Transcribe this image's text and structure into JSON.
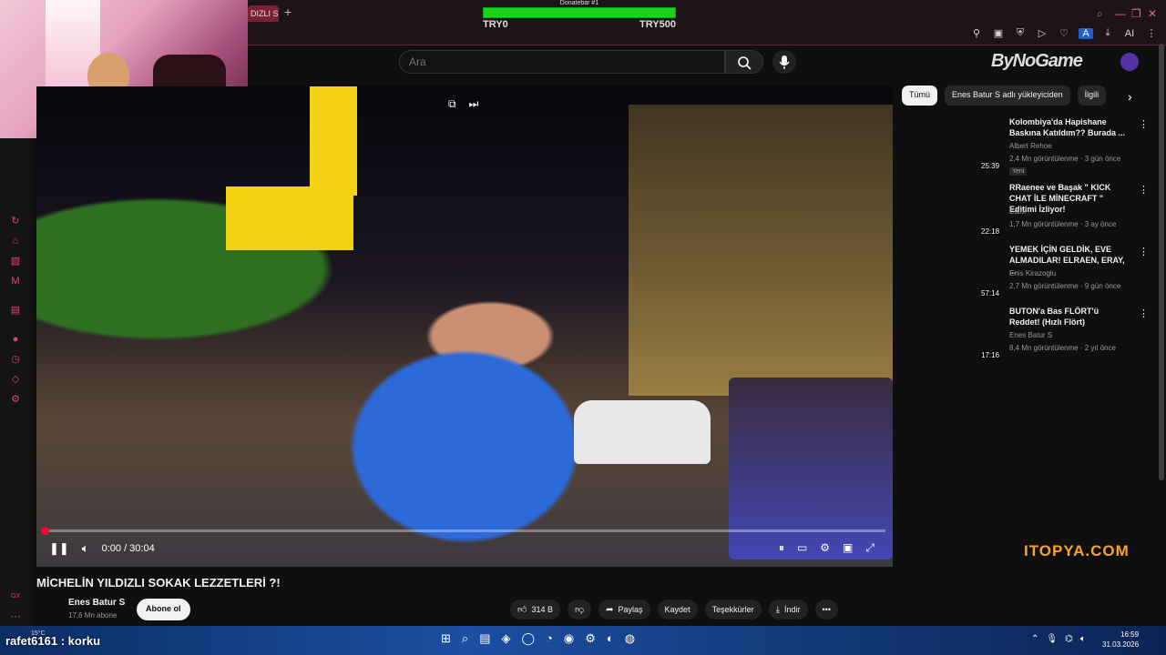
{
  "browser": {
    "tab_label": "DIZLI S(",
    "new_tab": "+",
    "accent": "#7a2136"
  },
  "donatebar": {
    "title": "Donatebar #1",
    "progress_fraction": 1.0,
    "min_label": "TRY0",
    "max_label": "TRY500",
    "fill_color": "#19d419"
  },
  "window_controls": {
    "search": "⌕",
    "minimize": "—",
    "restore": "❐",
    "close": "✕"
  },
  "extensions": [
    "pin-icon",
    "crop-icon",
    "shield-icon",
    "play-icon",
    "heart-icon",
    "A",
    "download-icon",
    "AI",
    "menu-icon"
  ],
  "ext_labels": {
    "a": "A",
    "ai": "AI"
  },
  "search": {
    "placeholder": "Ara"
  },
  "brand": {
    "logo_text": "ByNoGame"
  },
  "video": {
    "time": "0:00 / 30:04",
    "progress_fraction": 0.0,
    "accent": "#ff0033"
  },
  "chips": {
    "all": "Tümü",
    "uploads": "Enes Batur S adlı yükleyiciden",
    "related": "İlgili"
  },
  "recommendations": [
    {
      "title": "Kolombiya'da Hapishane Baskına Katıldım?? Burada ...",
      "channel": "Albert Rehoe",
      "meta": "2,4 Mn görüntülenme · 3 gün önce",
      "badge": "Yeni",
      "duration": "25:39"
    },
    {
      "title": "RRaenee ve Başak \" KICK CHAT İLE MİNECRAFT \" Editimi İzliyor!",
      "channel": "Edior",
      "meta": "1,7 Mn görüntülenme · 3 ay önce",
      "badge": "",
      "duration": "22:18"
    },
    {
      "title": "YEMEK İÇİN GELDİK, EVE ALMADILAR! ELRAEN, ERAY, ...",
      "channel": "Enis Kirazoglu",
      "meta": "2,7 Mn görüntülenme · 9 gün önce",
      "badge": "",
      "duration": "57:14"
    },
    {
      "title": "BUTON'a Bas FLÖRT'ü Reddet! (Hızlı Flört)",
      "channel": "Enes Batur S",
      "meta": "8,4 Mn görüntülenme · 2 yıl önce",
      "badge": "",
      "duration": "17:16"
    }
  ],
  "watermark": "ITOPYA.COM",
  "watch": {
    "title": "MİCHELİN YILDIZLI SOKAK LEZZETLERİ ?!",
    "channel": "Enes Batur S",
    "subscribers": "17,6 Mn abone",
    "subscribe_label": "Abone ol",
    "likes": "314 B",
    "share": "Paylaş",
    "save": "Kaydet",
    "thanks": "Teşekkürler",
    "download": "İndir",
    "more": "•••"
  },
  "stream_overlay": {
    "chat_message": "rafet6161 : korku",
    "weather": "15°C"
  },
  "taskbar": {
    "time": "16:59",
    "date": "31.03.2026"
  }
}
